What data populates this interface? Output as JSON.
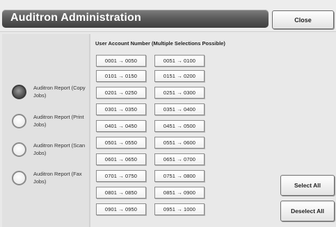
{
  "header": {
    "title": "Auditron Administration",
    "close_label": "Close"
  },
  "reports": [
    {
      "label": "Auditron Report (Copy Jobs)",
      "selected": true
    },
    {
      "label": "Auditron Report (Print Jobs)",
      "selected": false
    },
    {
      "label": "Auditron Report (Scan Jobs)",
      "selected": false
    },
    {
      "label": "Auditron Report (Fax Jobs)",
      "selected": false
    }
  ],
  "accounts": {
    "title": "User Account Number (Multiple Selections Possible)",
    "ranges": [
      "0001 → 0050",
      "0051 → 0100",
      "0101 → 0150",
      "0151 → 0200",
      "0201 → 0250",
      "0251 → 0300",
      "0301 → 0350",
      "0351 → 0400",
      "0401 → 0450",
      "0451 → 0500",
      "0501 → 0550",
      "0551 → 0600",
      "0601 → 0650",
      "0651 → 0700",
      "0701 → 0750",
      "0751 → 0800",
      "0801 → 0850",
      "0851 → 0900",
      "0901 → 0950",
      "0951 → 1000"
    ]
  },
  "actions": {
    "select_all": "Select All",
    "deselect_all": "Deselect All"
  }
}
